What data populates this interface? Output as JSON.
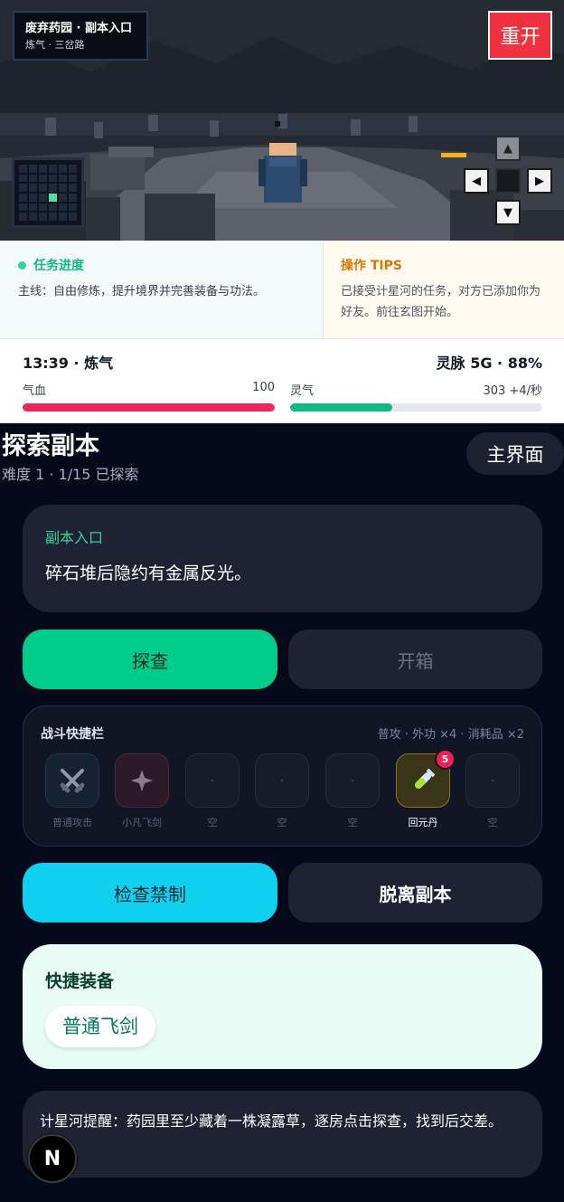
{
  "scene": {
    "location_title": "废弃药园 · 副本入口",
    "location_sub": "炼气 · 三岔路",
    "restart_label": "重开",
    "dpad": {
      "up": "▲",
      "left": "◀",
      "right": "▶",
      "down": "▼"
    },
    "minimap": {
      "cols": 6,
      "rows": 6,
      "player_col": 3,
      "player_row": 3
    }
  },
  "mission": {
    "heading": "任务进度",
    "text": "主线：自由修炼，提升境界并完善装备与功法。"
  },
  "tips": {
    "heading": "操作 TIPS",
    "text": "已接受计星河的任务，对方已添加你为好友。前往玄图开始。"
  },
  "status": {
    "time_realm": "13:39 · 炼气",
    "network": "灵脉 5G · 88%",
    "hp": {
      "label": "气血",
      "value": "100",
      "fill": 1.0,
      "color": "#f0255a"
    },
    "qi": {
      "label": "灵气",
      "value": "303 +4/秒",
      "fill": 0.405,
      "color": "#10b981"
    }
  },
  "dungeon": {
    "title": "探索副本",
    "subtitle": "难度 1 · 1/15 已探索",
    "home_label": "主界面",
    "entry": {
      "label": "副本入口",
      "text": "碎石堆后隐约有金属反光。"
    },
    "explore_label": "探查",
    "chest_label": "开箱",
    "hotbar": {
      "title": "战斗快捷栏",
      "info": "普攻 · 外功 ×4 · 消耗品 ×2",
      "slots": [
        {
          "label": "普通攻击",
          "icon": "crossed-swords-icon"
        },
        {
          "label": "小凡飞剑",
          "icon": "sparkle-icon"
        },
        {
          "label": "空",
          "icon": "empty-slot"
        },
        {
          "label": "空",
          "icon": "empty-slot"
        },
        {
          "label": "空",
          "icon": "empty-slot"
        },
        {
          "label": "回元丹",
          "icon": "test-tube-icon",
          "count": "5"
        },
        {
          "label": "空",
          "icon": "empty-slot"
        }
      ]
    },
    "inspect_label": "检查禁制",
    "leave_label": "脱离副本",
    "equip": {
      "title": "快捷装备",
      "item": "普通飞剑"
    },
    "hint": "计星河提醒：药园里至少藏着一株凝露草，逐房点击探查，找到后交差。"
  },
  "dev_badge": "N"
}
